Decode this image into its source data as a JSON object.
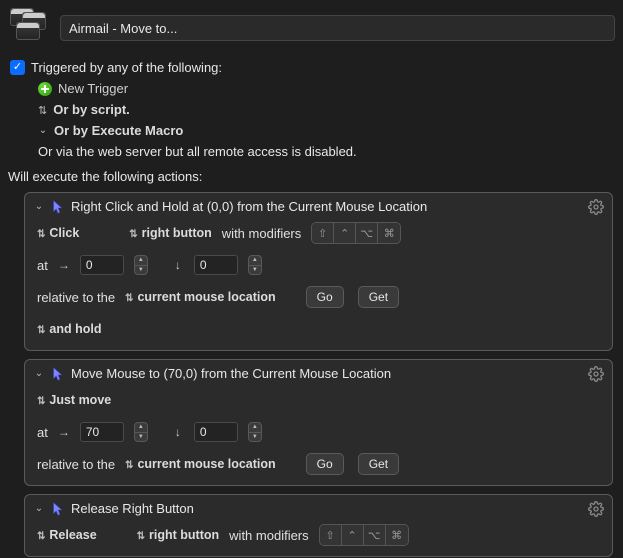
{
  "header": {
    "macro_name": "Airmail - Move to..."
  },
  "triggers": {
    "checked": true,
    "label": "Triggered by any of the following:",
    "new_trigger": "New Trigger",
    "by_script": "Or by script.",
    "by_execute_macro": "Or by Execute Macro",
    "web_server_note": "Or via the web server but all remote access is disabled."
  },
  "actions_header": "Will execute the following actions:",
  "actions": [
    {
      "title": "Right Click and Hold at (0,0) from the Current Mouse Location",
      "click": {
        "kind": "Click",
        "button": "right button",
        "with_modifiers_label": "with modifiers"
      },
      "coords": {
        "at_label": "at",
        "x": "0",
        "y": "0"
      },
      "relative": {
        "prefix": "relative to the",
        "value": "current mouse location",
        "go": "Go",
        "get": "Get"
      },
      "hold": "and hold"
    },
    {
      "title": "Move Mouse to (70,0) from the Current Mouse Location",
      "move": {
        "kind": "Just move"
      },
      "coords": {
        "at_label": "at",
        "x": "70",
        "y": "0"
      },
      "relative": {
        "prefix": "relative to the",
        "value": "current mouse location",
        "go": "Go",
        "get": "Get"
      }
    },
    {
      "title": "Release Right Button",
      "release": {
        "kind": "Release",
        "button": "right button",
        "with_modifiers_label": "with modifiers"
      }
    }
  ]
}
